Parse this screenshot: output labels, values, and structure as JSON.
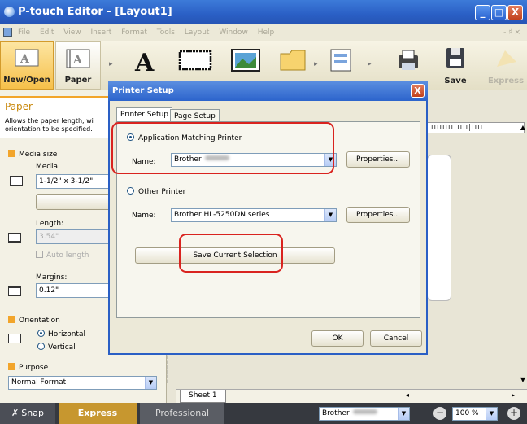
{
  "window": {
    "title": "P-touch Editor - [Layout1]",
    "min": "_",
    "max": "□",
    "close": "X"
  },
  "menu": [
    "File",
    "Edit",
    "View",
    "Insert",
    "Format",
    "Tools",
    "Layout",
    "Window",
    "Help"
  ],
  "menu_right": "- ♯ ×",
  "toolbar": {
    "new_open": "New/Open",
    "paper": "Paper",
    "save": "Save",
    "express": "Express"
  },
  "left_panel": {
    "header_title": "Paper",
    "header_desc_1": "Allows the paper length, wi",
    "header_desc_2": "orientation to be specified.",
    "media_size": "Media size",
    "media_label": "Media:",
    "media_value": "1-1/2\" x 3-1/2\"",
    "check_button": "Check M",
    "length_label": "Length:",
    "length_value": "3.54\"",
    "auto_length": "Auto length",
    "margins_label": "Margins:",
    "margins_value": "0.12\"",
    "orientation": "Orientation",
    "horizontal": "Horizontal",
    "vertical": "Vertical",
    "purpose": "Purpose",
    "purpose_value": "Normal Format"
  },
  "workspace": {
    "sheet_tab": "Sheet 1"
  },
  "dialog": {
    "title": "Printer Setup",
    "close": "X",
    "tab_printer": "Printer Setup",
    "tab_page": "Page Setup",
    "app_matching": "Application Matching Printer",
    "name_label_1": "Name:",
    "name_value_1": "Brother",
    "properties_1": "Properties...",
    "other_printer": "Other Printer",
    "name_label_2": "Name:",
    "name_value_2": "Brother HL-5250DN series",
    "properties_2": "Properties...",
    "save_selection": "Save Current Selection",
    "ok": "OK",
    "cancel": "Cancel"
  },
  "statusbar": {
    "snap": "Snap",
    "express": "Express",
    "professional": "Professional",
    "printer": "Brother",
    "zoom": "100 %"
  }
}
